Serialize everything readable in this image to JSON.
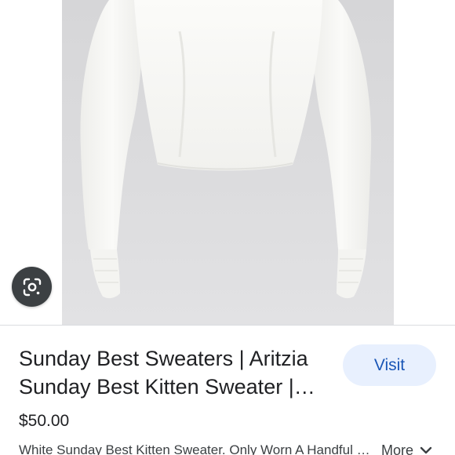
{
  "result": {
    "title": "Sunday Best Sweaters | Aritzia Sunday Best Kitten Sweater | Poshmark",
    "price": "$50.00",
    "description": "White Sunday Best Kitten Sweater. Only Worn A Handful Of Times",
    "more_label": "More"
  },
  "actions": {
    "visit_label": "Visit"
  },
  "icons": {
    "lens": "google-lens-icon",
    "more": "chevron-down-icon"
  },
  "colors": {
    "visit_bg": "#e8f0fe",
    "visit_text": "#1a56b6",
    "lens_bg": "#3c4043"
  }
}
